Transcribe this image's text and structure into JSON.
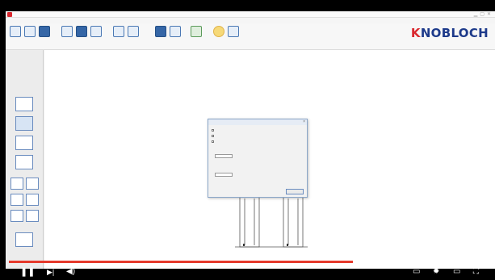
{
  "app": {
    "title": "",
    "menu": [
      "",
      "",
      "",
      ""
    ],
    "logo_prefix": "K",
    "logo_rest": "NOBLOCH",
    "brand_color": "#1d3a8a",
    "accent_color": "#d9272e"
  },
  "ribbon": {
    "tools": [
      {
        "icon": "new-file-icon",
        "label": ""
      },
      {
        "icon": "open-file-icon",
        "label": ""
      },
      {
        "icon": "save-icon",
        "label": ""
      },
      {
        "icon": "print-icon",
        "label": ""
      },
      {
        "icon": "text-tool-icon",
        "label": ""
      },
      {
        "icon": "measure-icon",
        "label": ""
      },
      {
        "icon": "layout-icon",
        "label": ""
      },
      {
        "icon": "view-icon",
        "label": ""
      },
      {
        "icon": "chart-icon",
        "label": ""
      },
      {
        "icon": "cabinet-icon",
        "label": ""
      },
      {
        "icon": "export-icon",
        "label": ""
      },
      {
        "icon": "bulb-icon",
        "label": ""
      },
      {
        "icon": "help-icon",
        "label": ""
      }
    ]
  },
  "left_panel": {
    "title": "",
    "subtitle": "",
    "info": "",
    "items": [
      "single-cabinet-icon",
      "base-cabinet-icon",
      "wall-cabinet-icon",
      "frame-icon",
      "double-cabinet-icon",
      "double-cabinet-icon",
      "double-cabinet-icon",
      "double-cabinet-icon",
      "double-cabinet-icon",
      "double-cabinet-icon",
      "accessory-icon"
    ]
  },
  "dialog": {
    "title": "",
    "options": [
      "",
      "",
      ""
    ],
    "text": "",
    "field_value": "",
    "text2": "",
    "field2_value": "",
    "ok_label": ""
  },
  "player": {
    "time_text": "",
    "progress_played": 0.72,
    "progress_buffered": 0.83,
    "progress_color": "#e53a2c",
    "icons": [
      "play-icon",
      "next-icon",
      "volume-icon",
      "subtitles-icon",
      "settings-icon",
      "miniplayer-icon",
      "fullscreen-icon"
    ]
  }
}
